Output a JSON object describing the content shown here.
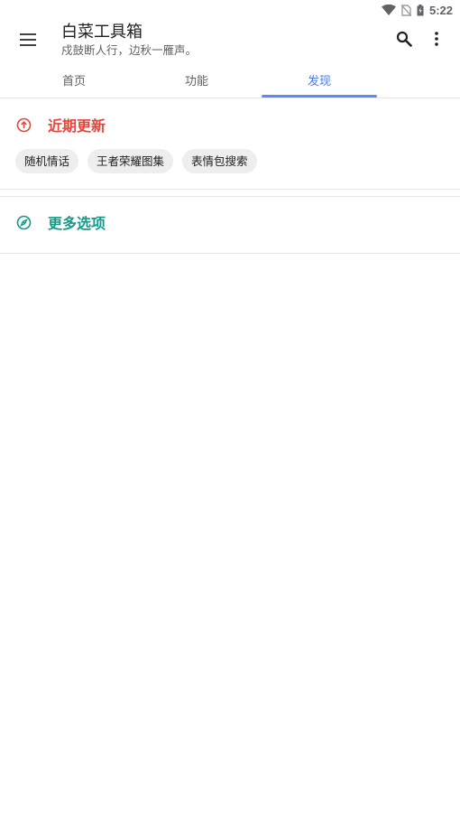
{
  "status_bar": {
    "time": "5:22",
    "icons": [
      "wifi-icon",
      "no-sim-icon",
      "battery-charging-icon"
    ]
  },
  "app_bar": {
    "title": "白菜工具箱",
    "subtitle": "戍鼓断人行，边秋一雁声。",
    "icons": [
      "menu-icon",
      "search-icon",
      "more-vert-icon"
    ]
  },
  "tabs": [
    {
      "label": "首页",
      "active": false
    },
    {
      "label": "功能",
      "active": false
    },
    {
      "label": "发现",
      "active": true
    }
  ],
  "sections": {
    "recent": {
      "title": "近期更新",
      "icon": "arrow-up-circle-icon",
      "color": "#e5453b",
      "chips": [
        "随机情话",
        "王者荣耀图集",
        "表情包搜索"
      ]
    },
    "more": {
      "title": "更多选项",
      "icon": "compass-icon",
      "color": "#149a88"
    }
  },
  "colors": {
    "accent": "#4a7ddc",
    "indicator": "#5b8def"
  }
}
